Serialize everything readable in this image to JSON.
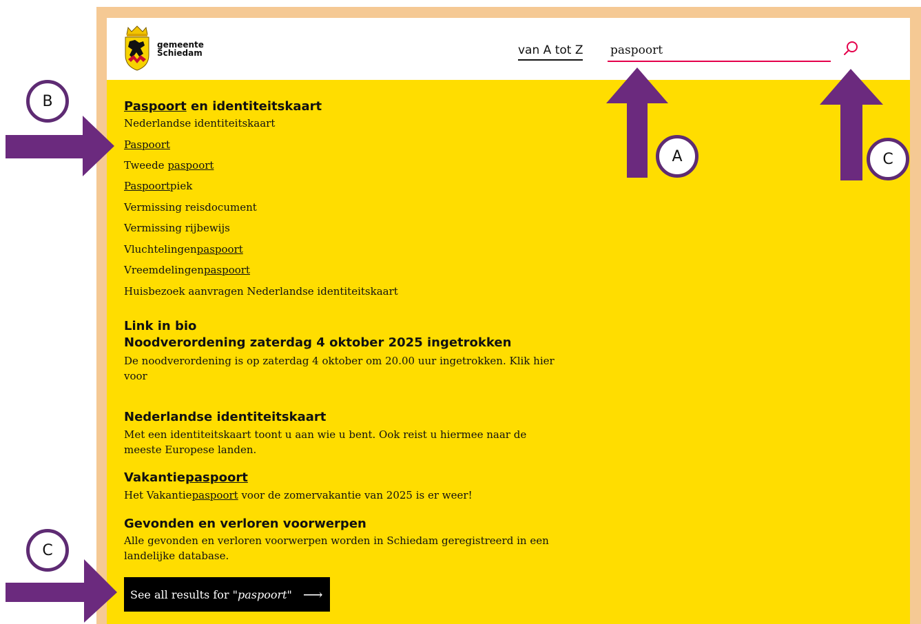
{
  "site": {
    "logo_text_line1": "gemeente",
    "logo_text_line2": "Schiedam"
  },
  "nav": {
    "az_label": "van A tot Z"
  },
  "search": {
    "value": "paspoort"
  },
  "suggestions": {
    "group_title_match": "Paspoort",
    "group_title_rest": " en identiteitskaart",
    "items": [
      {
        "pre": "Nederlandse identiteitskaart",
        "match": "",
        "post": ""
      },
      {
        "pre": "",
        "match": "Paspoort",
        "post": ""
      },
      {
        "pre": "Tweede ",
        "match": "paspoort",
        "post": ""
      },
      {
        "pre": "",
        "match": "Paspoort",
        "post": "piek"
      },
      {
        "pre": "Vermissing reisdocument",
        "match": "",
        "post": ""
      },
      {
        "pre": "Vermissing rijbewijs",
        "match": "",
        "post": ""
      },
      {
        "pre": "Vluchtelingen",
        "match": "paspoort",
        "post": ""
      },
      {
        "pre": "Vreemdelingen",
        "match": "paspoort",
        "post": ""
      },
      {
        "pre": "Huisbezoek aanvragen Nederlandse identiteitskaart",
        "match": "",
        "post": ""
      }
    ]
  },
  "results": [
    {
      "title": "Link in bio"
    },
    {
      "title": "Noodverordening zaterdag 4 oktober 2025 ingetrokken",
      "desc": "De noodverordening is op zaterdag 4 oktober om 20.00 uur ingetrokken. Klik hier voor"
    },
    {
      "title": "Nederlandse identiteitskaart",
      "desc": "Met een identiteitskaart toont u aan wie u bent. Ook reist u hiermee naar de meeste Europese landen."
    },
    {
      "title_pre": "Vakantie",
      "title_match": "paspoort",
      "desc_pre": "Het Vakantie",
      "desc_match": "paspoort",
      "desc_post": " voor de zomervakantie van 2025 is er weer!"
    },
    {
      "title": "Gevonden en verloren voorwerpen",
      "desc": "Alle gevonden en verloren voorwerpen worden in Schiedam geregistreerd in een landelijke database."
    }
  ],
  "see_all": {
    "prefix": "See all results for \"",
    "query": "paspoort",
    "suffix": "\"",
    "arrow": "⟶"
  },
  "callouts": {
    "a": "A",
    "b": "B",
    "c_top": "C",
    "c_bottom": "C"
  },
  "colors": {
    "frame": "#f5c994",
    "content_bg": "#ffdd00",
    "accent": "#e4004b",
    "annotation": "#6b2a7e"
  }
}
